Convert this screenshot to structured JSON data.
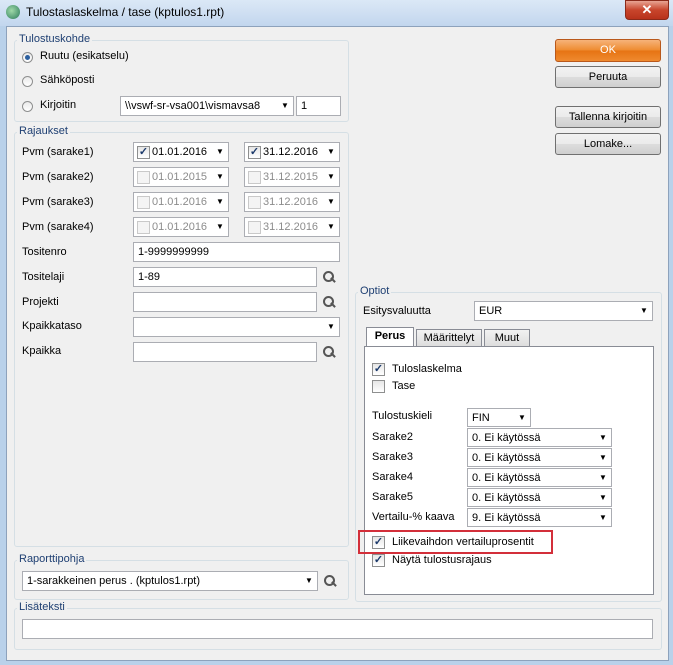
{
  "window": {
    "title": "Tulostaslaskelma / tase (kptulos1.rpt)",
    "close_label": "✕"
  },
  "tulostuskohde": {
    "group_label": "Tulostuskohde",
    "options": [
      "Ruutu (esikatselu)",
      "Sähköposti",
      "Kirjoitin"
    ],
    "selected": "Ruutu (esikatselu)",
    "printer_path": "\\\\vswf-sr-vsa001\\vismavsa8",
    "copies": "1"
  },
  "buttons": {
    "ok": "OK",
    "cancel": "Peruuta",
    "save_printer": "Tallenna kirjoitin",
    "form": "Lomake..."
  },
  "rajaukset": {
    "group_label": "Rajaukset",
    "dates": [
      {
        "label": "Pvm (sarake1)",
        "from": "01.01.2016",
        "to": "31.12.2016",
        "checked": true,
        "enabled": true
      },
      {
        "label": "Pvm (sarake2)",
        "from": "01.01.2015",
        "to": "31.12.2015",
        "checked": false,
        "enabled": false
      },
      {
        "label": "Pvm (sarake3)",
        "from": "01.01.2016",
        "to": "31.12.2016",
        "checked": false,
        "enabled": false
      },
      {
        "label": "Pvm (sarake4)",
        "from": "01.01.2016",
        "to": "31.12.2016",
        "checked": false,
        "enabled": false
      }
    ],
    "tositenro_label": "Tositenro",
    "tositenro_value": "1-9999999999",
    "tositelaji_label": "Tositelaji",
    "tositelaji_value": "1-89",
    "projekti_label": "Projekti",
    "projekti_value": "",
    "kpaikkataso_label": "Kpaikkataso",
    "kpaikkataso_value": "",
    "kpaikka_label": "Kpaikka",
    "kpaikka_value": ""
  },
  "optiot": {
    "group_label": "Optiot",
    "currency_label": "Esitysvaluutta",
    "currency_value": "EUR",
    "tabs": [
      "Perus",
      "Määrittelyt",
      "Muut"
    ],
    "active_tab": "Perus",
    "tulos_label": "Tuloslaskelma",
    "tulos_checked": true,
    "tase_label": "Tase",
    "tase_checked": false,
    "lang_label": "Tulostuskieli",
    "lang_value": "FIN",
    "sarake2_label": "Sarake2",
    "sarake2_value": "0. Ei käytössä",
    "sarake3_label": "Sarake3",
    "sarake3_value": "0. Ei käytössä",
    "sarake4_label": "Sarake4",
    "sarake4_value": "0. Ei käytössä",
    "sarake5_label": "Sarake5",
    "sarake5_value": "0. Ei käytössä",
    "vertailu_label": "Vertailu-% kaava",
    "vertailu_value": "9. Ei käytössä",
    "liikevaihto_label": "Liikevaihdon vertailuprosentit",
    "liikevaihto_checked": true,
    "nayta_label": "Näytä tulostusrajaus",
    "nayta_checked": true
  },
  "raporttipohja": {
    "group_label": "Raporttipohja",
    "value": "1-sarakkeinen perus . (kptulos1.rpt)"
  },
  "lisateksti": {
    "group_label": "Lisäteksti",
    "value": ""
  },
  "colors": {
    "accent": "#ee8a2e",
    "highlight": "#d32f3a",
    "group_label": "#1e3f72"
  }
}
